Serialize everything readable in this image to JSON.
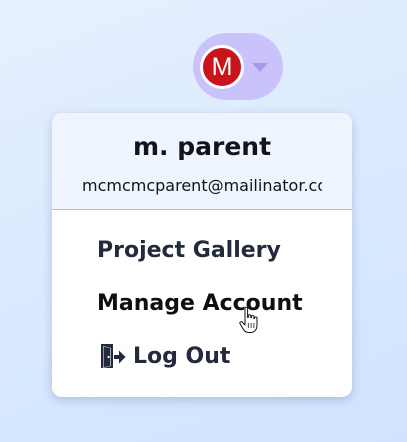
{
  "account_button": {
    "avatar_initial": "M",
    "avatar_color": "#c8141a",
    "pill_color": "#c9c2fb",
    "expanded_icon": "chevron-down-icon"
  },
  "dropdown": {
    "user_name": "m. parent",
    "user_email": "mcmcmcparent@mailinator.com",
    "items": [
      {
        "label": "Project Gallery"
      },
      {
        "label": "Manage Account"
      },
      {
        "label": "Log Out",
        "icon": "logout-icon"
      }
    ]
  },
  "cursor": {
    "icon": "hand-pointer-icon",
    "hovered_item": "Manage Account"
  }
}
